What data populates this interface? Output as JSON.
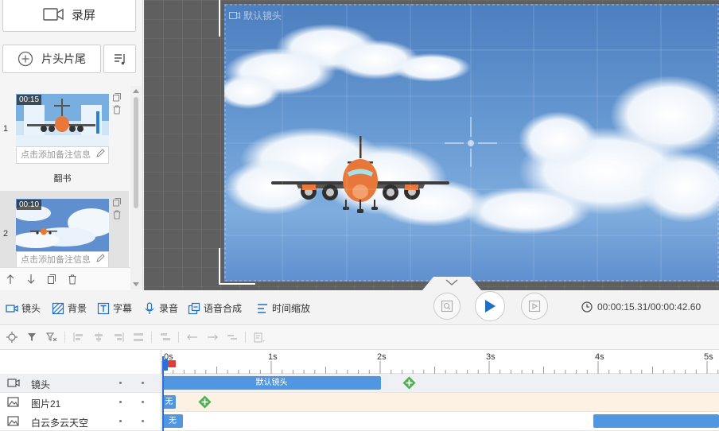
{
  "left_panel": {
    "record_label": "录屏",
    "intro_outro_label": "片头片尾",
    "scenes": [
      {
        "number": "1",
        "duration": "00:15",
        "note_placeholder": "点击添加备注信息",
        "title": "翻书"
      },
      {
        "number": "2",
        "duration": "00:10",
        "note_placeholder": "点击添加备注信息",
        "title": ""
      }
    ]
  },
  "canvas": {
    "camera_label": "默认镜头"
  },
  "toolbar": {
    "tools": [
      "镜头",
      "背景",
      "字幕",
      "录音",
      "语音合成",
      "时间缩放"
    ],
    "timecode": "00:00:15.31/00:00:42.60"
  },
  "timeline": {
    "ruler_labels": [
      "0s",
      "1s",
      "2s",
      "3s",
      "4s",
      "5s"
    ],
    "tracks": [
      {
        "name": "镜头",
        "icon": "camera-icon",
        "clip_label": "默认镜头"
      },
      {
        "name": "图片21",
        "icon": "image-icon",
        "clip_label": "无"
      },
      {
        "name": "白云多云天空",
        "icon": "image-icon",
        "clip_label": "无"
      }
    ]
  },
  "colors": {
    "accent": "#2b6fd8",
    "clip": "#5196e0",
    "image_track_bg": "#fdf1e4",
    "keyframe_add": "#4caf50"
  }
}
